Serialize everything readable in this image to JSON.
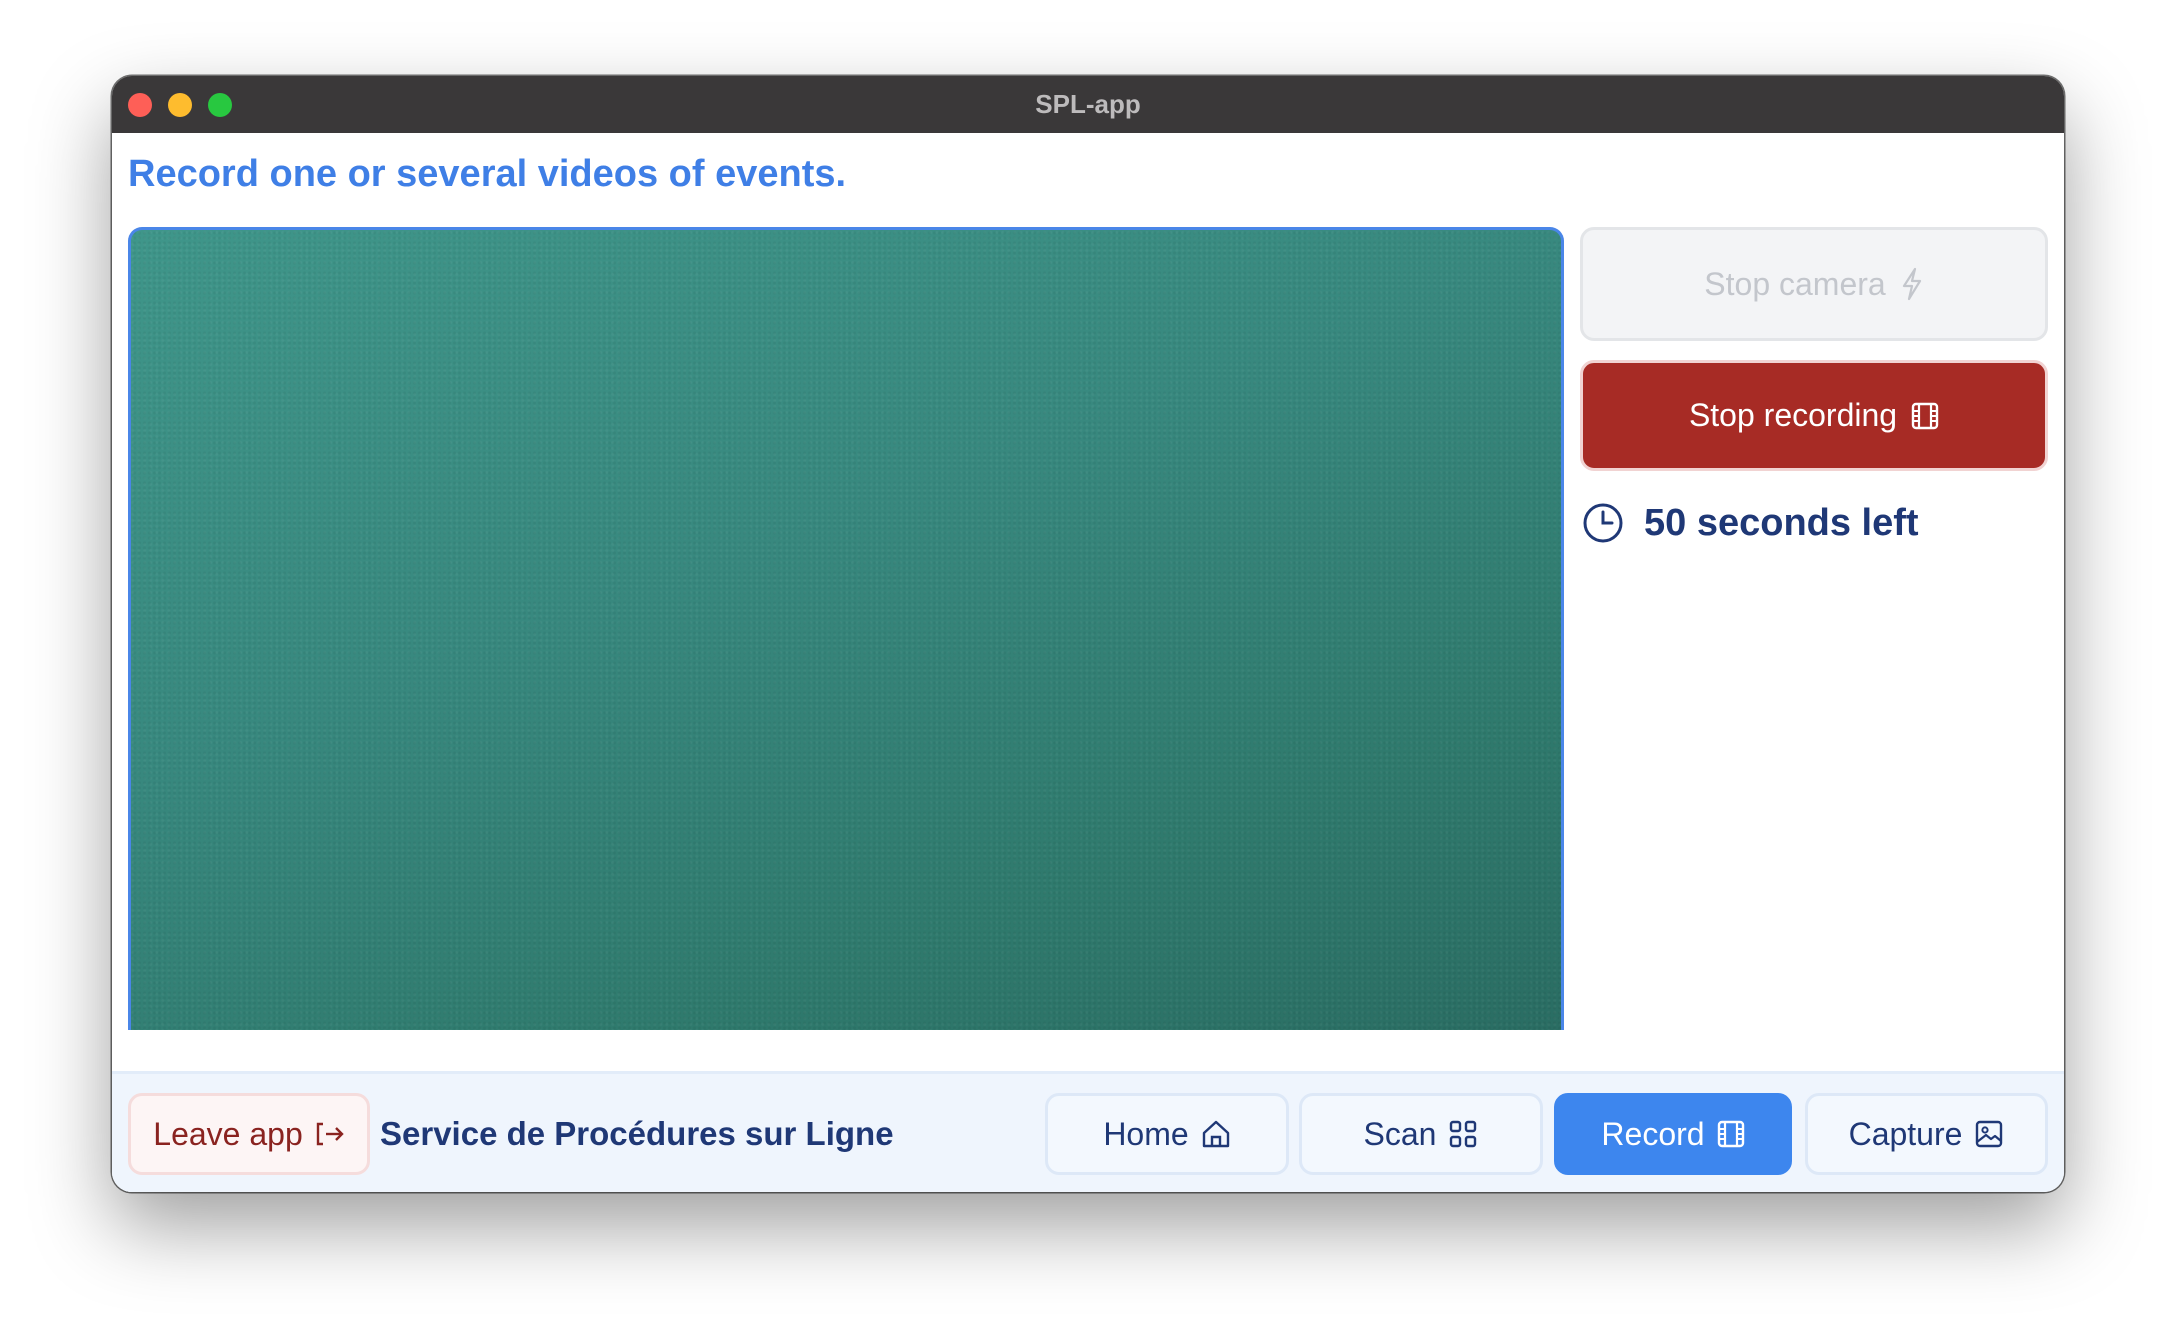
{
  "window": {
    "title": "SPL-app"
  },
  "page": {
    "title": "Record one or several videos of events."
  },
  "camera_controls": {
    "stop_camera_label": "Stop camera",
    "stop_recording_label": "Stop recording",
    "timer_text": "50 seconds left"
  },
  "footer": {
    "leave_label": "Leave app",
    "service_name": "Service de Procédures sur Ligne",
    "nav": {
      "home_label": "Home",
      "scan_label": "Scan",
      "record_label": "Record",
      "capture_label": "Capture",
      "active": "Record"
    }
  },
  "icons": {
    "stop_camera": "lightning-icon",
    "stop_recording": "film-icon",
    "timer": "clock-icon",
    "leave": "logout-icon",
    "home": "home-icon",
    "scan": "grid-icon",
    "record": "film-icon",
    "capture": "image-icon"
  },
  "colors": {
    "accent": "#3d86ee",
    "title": "#3f7fe6",
    "danger": "#a72b25",
    "text_dark": "#1f3876",
    "leave_text": "#8a2320",
    "video_feed": "#38897f"
  }
}
